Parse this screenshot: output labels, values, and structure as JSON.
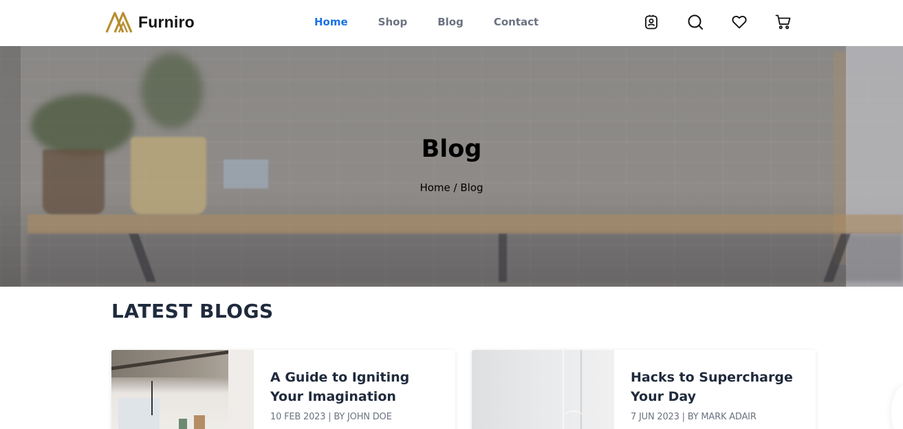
{
  "brand": {
    "name": "Furniro",
    "accent": "#b88e2f"
  },
  "nav": {
    "items": [
      {
        "label": "Home",
        "active": true
      },
      {
        "label": "Shop",
        "active": false
      },
      {
        "label": "Blog",
        "active": false
      },
      {
        "label": "Contact",
        "active": false
      }
    ],
    "active_color": "#1a73e8"
  },
  "header_icons": [
    "account-icon",
    "search-icon",
    "heart-icon",
    "cart-icon"
  ],
  "hero": {
    "title": "Blog",
    "breadcrumb": "Home / Blog"
  },
  "latest": {
    "title": "LATEST BLOGS",
    "posts": [
      {
        "title": "A Guide to Igniting Your Imagination",
        "meta": "10 FEB 2023 | BY JOHN DOE"
      },
      {
        "title": "Hacks to Supercharge Your Day",
        "meta": "7 JUN 2023 | BY MARK ADAIR"
      }
    ]
  }
}
